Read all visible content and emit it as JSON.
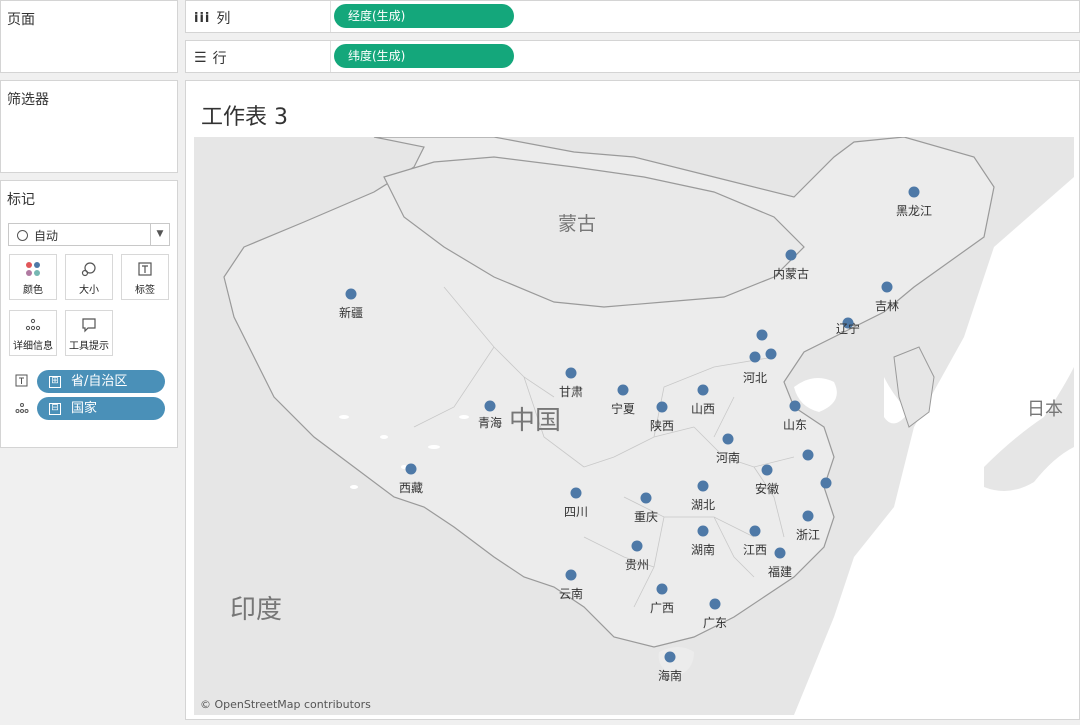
{
  "sidebar": {
    "pages_title": "页面",
    "filters_title": "筛选器",
    "marks_title": "标记",
    "mark_type": "自动",
    "mark_buttons": [
      {
        "label": "颜色",
        "icon": "color-dots-icon"
      },
      {
        "label": "大小",
        "icon": "size-icon"
      },
      {
        "label": "标签",
        "icon": "label-icon"
      },
      {
        "label": "详细信息",
        "icon": "detail-icon"
      },
      {
        "label": "工具提示",
        "icon": "tooltip-icon"
      }
    ],
    "mark_fields": [
      {
        "label": "省/自治区",
        "expand": "⊞"
      },
      {
        "label": "国家",
        "expand": "⊟"
      }
    ]
  },
  "shelves": {
    "columns": {
      "label": "列",
      "pill": "经度(生成)"
    },
    "rows": {
      "label": "行",
      "pill": "纬度(生成)"
    }
  },
  "sheet": {
    "title": "工作表 3",
    "attribution": "© OpenStreetMap contributors"
  },
  "map": {
    "colors": {
      "water": "#ffffff",
      "land": "#e6e6e6",
      "china": "#ececec",
      "border": "#9a9a9a",
      "dot": "#4e79a7"
    },
    "countries": [
      {
        "name": "蒙古"
      },
      {
        "name": "中国"
      },
      {
        "name": "印度"
      },
      {
        "name": "日本"
      }
    ],
    "provinces": [
      {
        "name": "黑龙江"
      },
      {
        "name": "内蒙古"
      },
      {
        "name": "吉林"
      },
      {
        "name": "辽宁"
      },
      {
        "name": "新疆"
      },
      {
        "name": "河北"
      },
      {
        "name": ""
      },
      {
        "name": ""
      },
      {
        "name": "甘肃"
      },
      {
        "name": "宁夏"
      },
      {
        "name": "山西"
      },
      {
        "name": "陕西"
      },
      {
        "name": "青海"
      },
      {
        "name": "山东"
      },
      {
        "name": "河南"
      },
      {
        "name": "西藏"
      },
      {
        "name": "安徽"
      },
      {
        "name": ""
      },
      {
        "name": ""
      },
      {
        "name": "四川"
      },
      {
        "name": "重庆"
      },
      {
        "name": "湖北"
      },
      {
        "name": "浙江"
      },
      {
        "name": "贵州"
      },
      {
        "name": "湖南"
      },
      {
        "name": "江西"
      },
      {
        "name": "福建"
      },
      {
        "name": "云南"
      },
      {
        "name": "广西"
      },
      {
        "name": "广东"
      },
      {
        "name": "海南"
      }
    ]
  }
}
